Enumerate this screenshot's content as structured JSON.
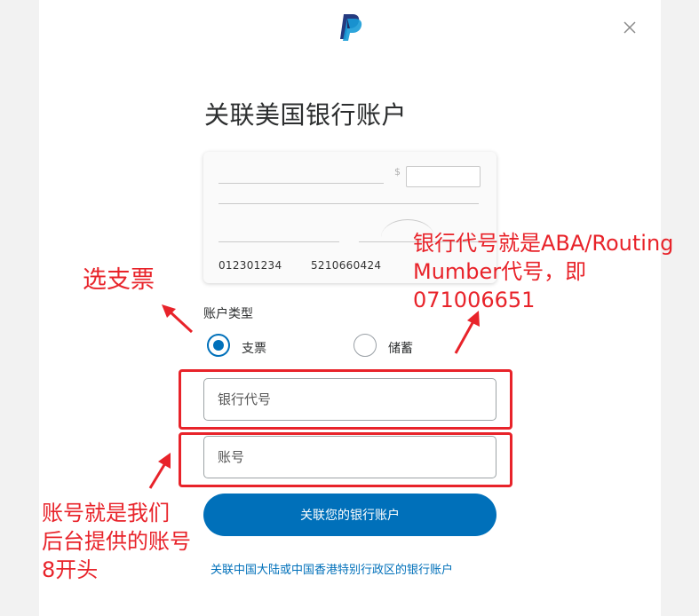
{
  "dialog": {
    "title": "关联美国银行账户",
    "logo_icon": "paypal-logo",
    "close_icon": "close-icon"
  },
  "check_illustration": {
    "currency_symbol": "$",
    "routing_number": "012301234",
    "account_number": "5210660424"
  },
  "account_type": {
    "label": "账户类型",
    "options": [
      {
        "label": "支票",
        "selected": true
      },
      {
        "label": "储蓄",
        "selected": false
      }
    ]
  },
  "form": {
    "routing_placeholder": "银行代号",
    "routing_value": "",
    "account_placeholder": "账号",
    "account_value": ""
  },
  "submit_label": "关联您的银行账户",
  "china_link": "关联中国大陆或中国香港特别行政区的银行账户",
  "annotations": {
    "select_check": "选支票",
    "routing_note": [
      "银行代号就是ABA/Routing",
      "Mumber代号，即",
      "071006651"
    ],
    "account_note": [
      "账号就是我们",
      "后台提供的账号",
      "8开头"
    ]
  },
  "colors": {
    "accent": "#0070ba",
    "annotation_red": "#e8232a",
    "paypal_dark": "#253b80",
    "paypal_light": "#179bd7"
  }
}
